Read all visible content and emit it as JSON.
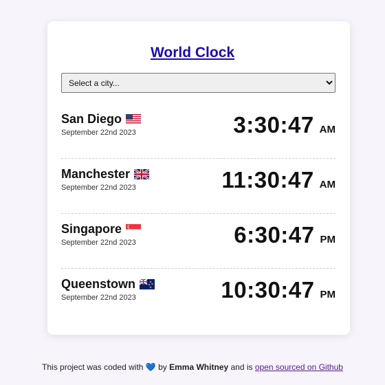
{
  "header": {
    "title": "World Clock"
  },
  "selector": {
    "selected": "Select a city..."
  },
  "clocks": [
    {
      "city": "San Diego",
      "flag": "us-flag",
      "date": "September 22nd 2023",
      "time": "3:30:47",
      "period": "AM"
    },
    {
      "city": "Manchester",
      "flag": "uk-flag",
      "date": "September 22nd 2023",
      "time": "11:30:47",
      "period": "AM"
    },
    {
      "city": "Singapore",
      "flag": "sg-flag",
      "date": "September 22nd 2023",
      "time": "6:30:47",
      "period": "PM"
    },
    {
      "city": "Queenstown",
      "flag": "nz-flag",
      "date": "September 22nd 2023",
      "time": "10:30:47",
      "period": "PM"
    }
  ],
  "footer": {
    "prefix": "This project was coded with",
    "heart": "💙",
    "by": "by",
    "author": "Emma Whitney",
    "middle": "and is",
    "link_text": "open sourced on Github"
  },
  "colors": {
    "background": "#f7f4fc",
    "card": "#ffffff",
    "title_link": "#1a0dab",
    "footer_link": "#551a8b",
    "heart": "#4a90e2"
  }
}
